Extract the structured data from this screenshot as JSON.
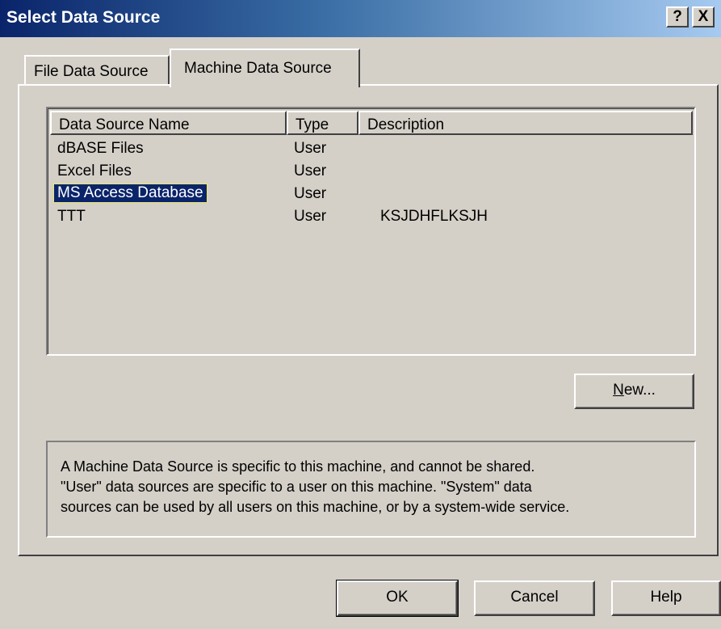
{
  "window": {
    "title": "Select Data Source",
    "help_label": "?",
    "close_label": "X"
  },
  "tabs": [
    {
      "label": "File Data Source",
      "active": false
    },
    {
      "label": "Machine Data Source",
      "active": true
    }
  ],
  "list": {
    "columns": [
      "Data Source Name",
      "Type",
      "Description"
    ],
    "rows": [
      {
        "name": "dBASE Files",
        "type": "User",
        "description": ""
      },
      {
        "name": "Excel Files",
        "type": "User",
        "description": ""
      },
      {
        "name": "MS Access Database",
        "type": "User",
        "description": "",
        "selected": true
      },
      {
        "name": "TTT",
        "type": "User",
        "description": "KSJDHFLKSJH"
      }
    ]
  },
  "buttons": {
    "new_prefix": "N",
    "new_rest": "ew...",
    "ok": "OK",
    "cancel": "Cancel",
    "help": "Help"
  },
  "description_lines": [
    "A Machine Data Source is specific to this machine, and cannot be shared.",
    "\"User\" data sources are specific to a user on this machine.  \"System\" data",
    "sources can be used by all users on this machine, or by a system-wide service."
  ],
  "colors": {
    "face": "#d4d0c8",
    "selection": "#0a246a",
    "title_start": "#0a246a"
  }
}
